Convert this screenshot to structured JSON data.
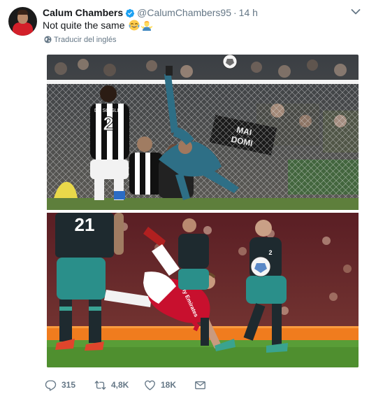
{
  "tweet": {
    "display_name": "Calum Chambers",
    "handle": "@CalumChambers95",
    "separator": "·",
    "time": "14 h",
    "text": "Not quite the same",
    "emoji": [
      "face-with-tears-of-joy",
      "man-shrugging"
    ],
    "translate_label": "Traducir del inglés",
    "verified": true
  },
  "photos": {
    "top": {
      "description_colors": {
        "juve_kit": "#ffffff",
        "madrid_kit": "#2e6f86",
        "net": "#ffffff"
      },
      "visible_text": {
        "jersey_number": "2",
        "jersey_name": "DE SCIGLIO",
        "banner": "MAI DOMI"
      }
    },
    "bottom": {
      "description_colors": {
        "arsenal_shirt": "#c8102e",
        "southampton_kit": "#1e2a2f",
        "pitch": "#4f8f2f"
      },
      "visible_text": {
        "jersey_number_left": "21",
        "jersey_number_right": "2",
        "shirt_sponsor": "Fly Emirates"
      }
    }
  },
  "actions": {
    "replies": "315",
    "retweets": "4,8K",
    "likes": "18K"
  },
  "colors": {
    "text_primary": "#14171a",
    "text_secondary": "#657786",
    "verified_blue": "#1da1f2"
  }
}
